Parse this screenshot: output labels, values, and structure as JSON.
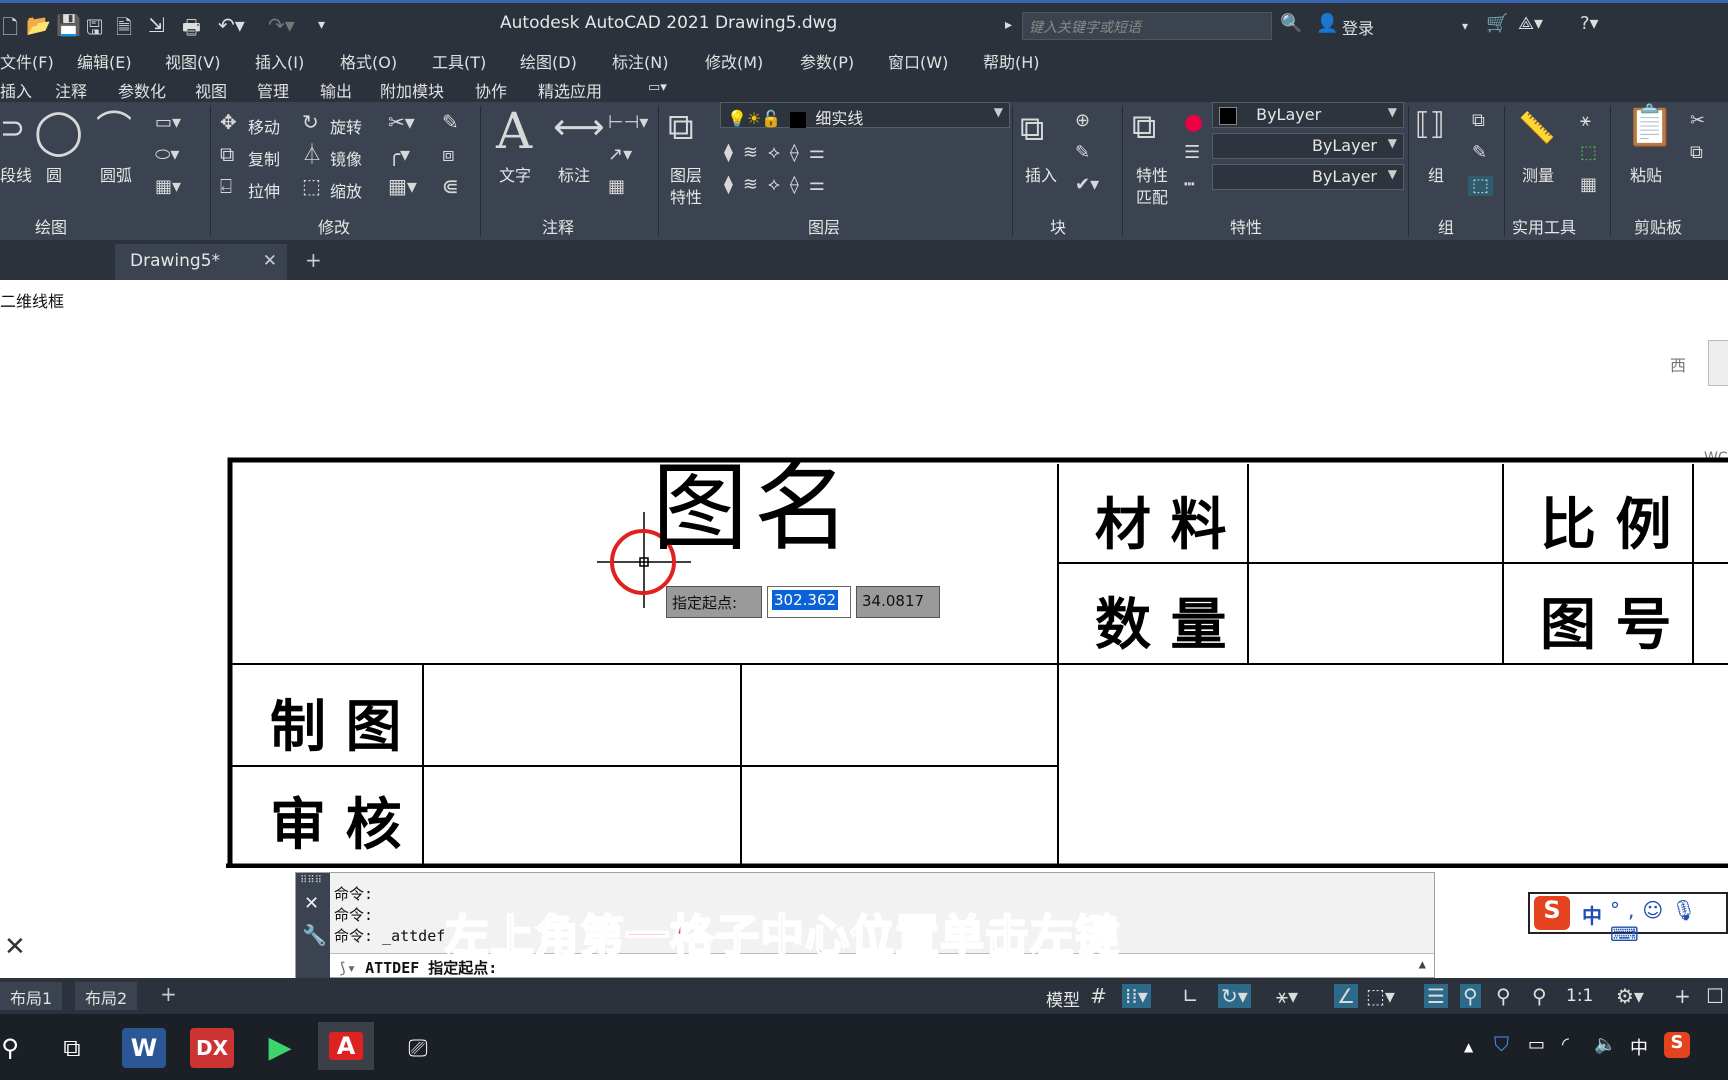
{
  "titlebar": {
    "app_title": "Autodesk AutoCAD 2021    Drawing5.dwg",
    "search_placeholder": "键入关键字或短语",
    "login": "登录"
  },
  "menu": [
    "文件(F)",
    "编辑(E)",
    "视图(V)",
    "插入(I)",
    "格式(O)",
    "工具(T)",
    "绘图(D)",
    "标注(N)",
    "修改(M)",
    "参数(P)",
    "窗口(W)",
    "帮助(H)"
  ],
  "ribbon_tabs": [
    "插入",
    "注释",
    "参数化",
    "视图",
    "管理",
    "输出",
    "附加模块",
    "协作",
    "精选应用"
  ],
  "ribbon": {
    "draw": {
      "title": "绘图",
      "polyline": "段线",
      "circle": "圆",
      "arc": "圆弧"
    },
    "modify": {
      "title": "修改",
      "move": "移动",
      "rotate": "旋转",
      "copy": "复制",
      "mirror": "镜像",
      "stretch": "拉伸",
      "scale": "缩放"
    },
    "annotation": {
      "title": "注释",
      "text": "文字",
      "dim": "标注"
    },
    "layers": {
      "title": "图层",
      "props_line1": "图层",
      "props_line2": "特性",
      "current_layer": "细实线"
    },
    "block": {
      "title": "块",
      "insert": "插入"
    },
    "properties": {
      "title": "特性",
      "match1": "特性",
      "match2": "匹配",
      "color": "ByLayer",
      "linetype": "ByLayer",
      "lineweight": "ByLayer"
    },
    "groups": {
      "title": "组",
      "group": "组"
    },
    "utilities": {
      "title": "实用工具",
      "measure": "测量"
    },
    "clipboard": {
      "title": "剪贴板",
      "paste": "粘贴"
    }
  },
  "doc_tab": {
    "label": "Drawing5*"
  },
  "viewport": {
    "view_label": "二维线框",
    "viewcube_west": "西",
    "wcs": "WCS",
    "title_block": {
      "title": "图名",
      "material": "材 料",
      "quantity": "数 量",
      "scale": "比 例",
      "drawing_no": "图 号",
      "drafter": "制 图",
      "reviewer": "审 核"
    },
    "prompt": {
      "label": "指定起点:",
      "x_value": "302.362",
      "y_value": "34.0817"
    }
  },
  "command": {
    "line1": "命令:",
    "line2": "命令:",
    "line3": "命令: _attdef",
    "input": "ATTDEF 指定起点:"
  },
  "subtitle": "左上角第一格子中心位置单击左键",
  "layout_tabs": [
    "布局1",
    "布局2"
  ],
  "status": {
    "model": "模型",
    "scale": "1:1"
  },
  "ime": {
    "lang": "中"
  },
  "tray": {
    "lang": "中"
  }
}
